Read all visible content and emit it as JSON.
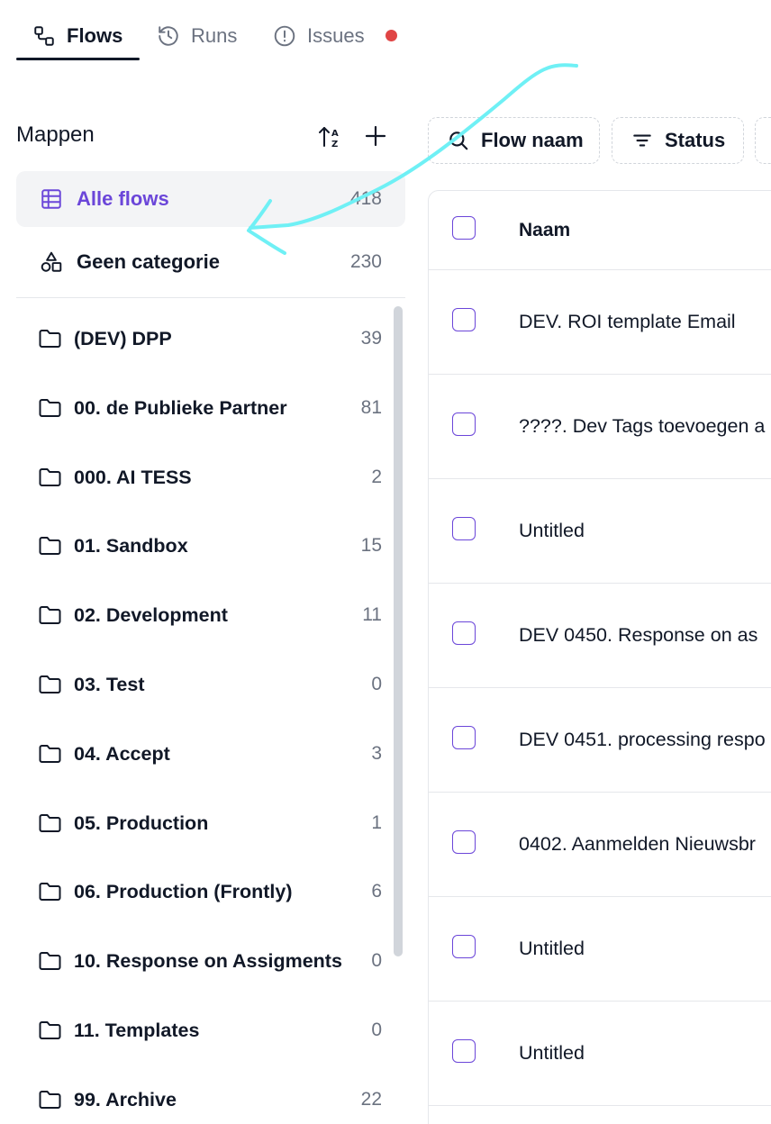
{
  "tabs": {
    "flows": "Flows",
    "runs": "Runs",
    "issues": "Issues"
  },
  "sidebar": {
    "title": "Mappen",
    "all_flows": {
      "label": "Alle flows",
      "count": "418"
    },
    "uncategorized": {
      "label": "Geen categorie",
      "count": "230"
    },
    "folders": [
      {
        "label": "(DEV) DPP",
        "count": "39"
      },
      {
        "label": "00. de Publieke Partner",
        "count": "81"
      },
      {
        "label": "000. AI TESS",
        "count": "2"
      },
      {
        "label": "01. Sandbox",
        "count": "15"
      },
      {
        "label": "02. Development",
        "count": "11"
      },
      {
        "label": "03. Test",
        "count": "0"
      },
      {
        "label": "04. Accept",
        "count": "3"
      },
      {
        "label": "05. Production",
        "count": "1"
      },
      {
        "label": "06. Production (Frontly)",
        "count": "6"
      },
      {
        "label": "10. Response on Assigments",
        "count": "0"
      },
      {
        "label": "11. Templates",
        "count": "0"
      },
      {
        "label": "99. Archive",
        "count": "22"
      }
    ]
  },
  "filters": {
    "name": "Flow naam",
    "status": "Status"
  },
  "table": {
    "header_name": "Naam",
    "rows": [
      {
        "name": "DEV. ROI template Email"
      },
      {
        "name": "????. Dev Tags toevoegen a"
      },
      {
        "name": "Untitled"
      },
      {
        "name": "DEV 0450. Response on as"
      },
      {
        "name": "DEV 0451. processing respo"
      },
      {
        "name": "0402. Aanmelden Nieuwsbr"
      },
      {
        "name": "Untitled"
      },
      {
        "name": "Untitled"
      }
    ]
  },
  "colors": {
    "accent": "#6b46d9",
    "issue_dot": "#e04545",
    "annotation_arrow": "#6ff0f5"
  },
  "icons": [
    "flows-icon",
    "history-icon",
    "alert-circle-icon",
    "sort-az-icon",
    "plus-icon",
    "table-icon",
    "shapes-icon",
    "folder-icon",
    "search-icon",
    "filter-icon"
  ]
}
